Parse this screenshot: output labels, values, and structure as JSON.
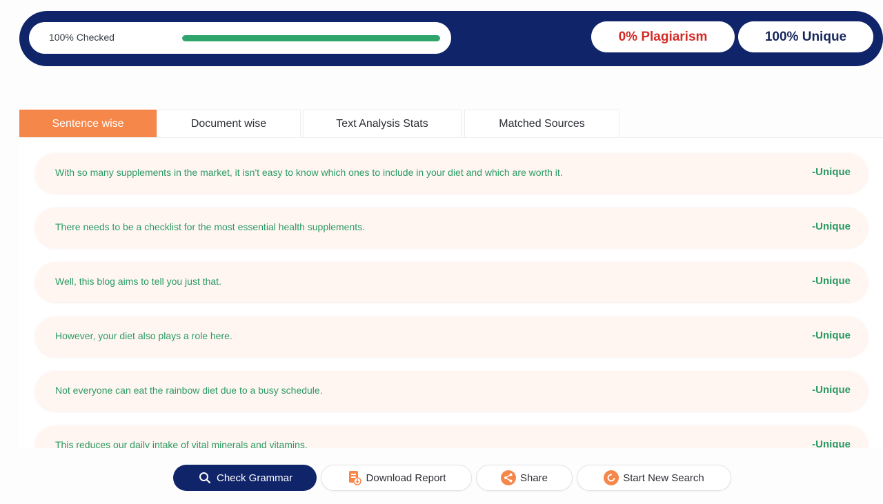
{
  "status": {
    "checked_label": "100% Checked",
    "progress_fraction": 1.0,
    "plagiarism_label": "0% Plagiarism",
    "unique_label": "100% Unique"
  },
  "tabs": [
    {
      "label": "Sentence wise",
      "active": true
    },
    {
      "label": "Document wise",
      "active": false
    },
    {
      "label": "Text Analysis Stats",
      "active": false
    },
    {
      "label": "Matched Sources",
      "active": false
    }
  ],
  "sentences": [
    {
      "text": "With so many supplements in the market, it isn't easy to know which ones to include in your diet and which are worth it.",
      "status": "-Unique"
    },
    {
      "text": "There needs to be a checklist for the most essential health supplements.",
      "status": "-Unique"
    },
    {
      "text": "Well, this blog aims to tell you just that.",
      "status": "-Unique"
    },
    {
      "text": "However, your diet also plays a role here.",
      "status": "-Unique"
    },
    {
      "text": "Not everyone can eat the rainbow diet due to a busy schedule.",
      "status": "-Unique"
    },
    {
      "text": "This reduces our daily intake of vital minerals and vitamins.",
      "status": "-Unique"
    }
  ],
  "actions": {
    "check_grammar": "Check Grammar",
    "download_report": "Download Report",
    "share": "Share",
    "start_new_search": "Start New Search"
  },
  "icons": {
    "check_grammar": "search-icon",
    "download_report": "document-icon",
    "share": "share-icon",
    "start_new_search": "refresh-icon"
  },
  "colors": {
    "navy": "#10246a",
    "accent_orange": "#f6874a",
    "unique_green": "#2a9a63",
    "plagiarism_red": "#d42a26",
    "progress_green": "#2fa56b"
  }
}
